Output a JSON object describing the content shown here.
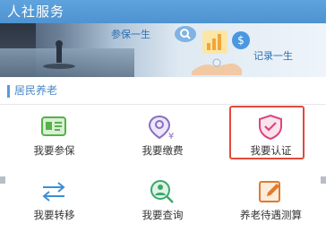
{
  "header": {
    "title": "人社服务"
  },
  "banner": {
    "text_left": "参保一生",
    "text_right": "记录一生"
  },
  "section": {
    "title": "居民养老"
  },
  "grid": {
    "items": [
      {
        "label": "我要参保",
        "icon": "id-card-icon",
        "color": "#55b24a"
      },
      {
        "label": "我要缴费",
        "icon": "location-yen-icon",
        "color": "#8a6dc4"
      },
      {
        "label": "我要认证",
        "icon": "shield-check-icon",
        "color": "#d9457f",
        "highlighted": true
      },
      {
        "label": "我要转移",
        "icon": "transfer-arrows-icon",
        "color": "#3b8fd6"
      },
      {
        "label": "我要查询",
        "icon": "search-person-icon",
        "color": "#3aa86b"
      },
      {
        "label": "养老待遇测算",
        "icon": "edit-calc-icon",
        "color": "#e07a2e"
      }
    ]
  },
  "colors": {
    "header_bg": "#5b9bd5",
    "accent_text": "#4a88c6",
    "highlight_border": "#e24a3b"
  }
}
